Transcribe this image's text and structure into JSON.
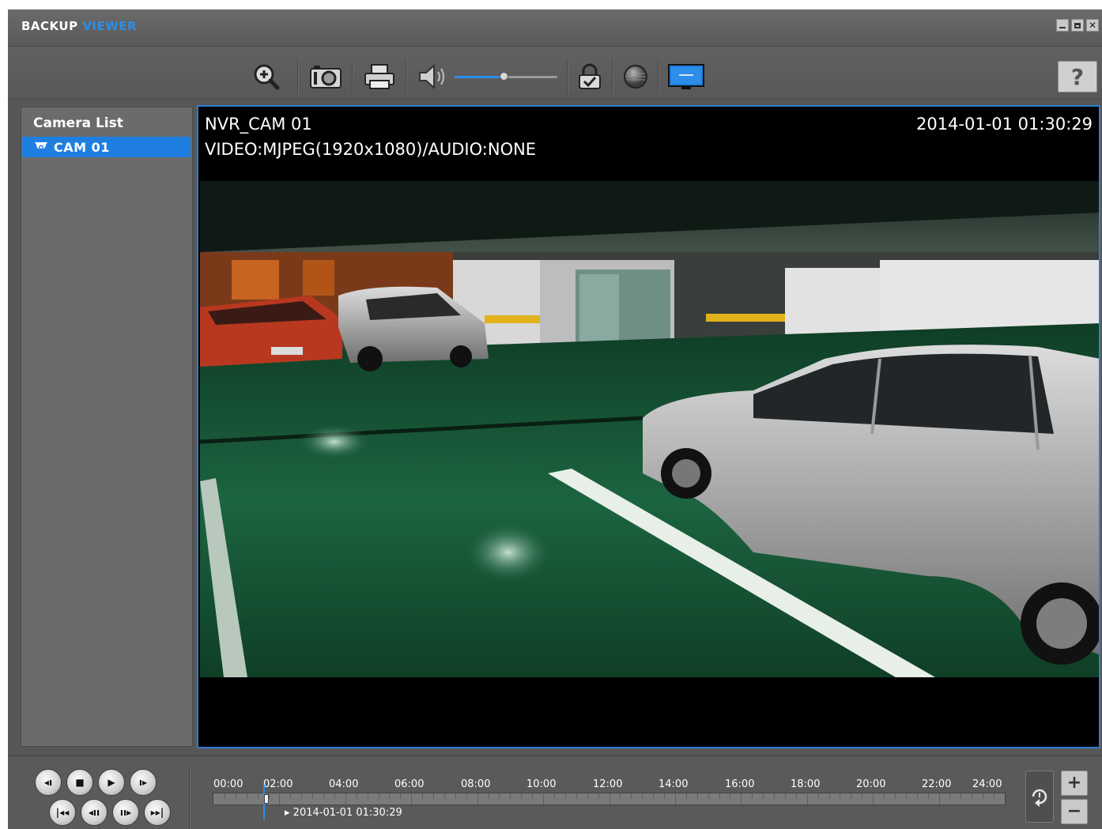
{
  "window": {
    "title_part1": "BACKUP",
    "title_part2": "VIEWER"
  },
  "toolbar": {
    "icons": [
      "zoom-in-icon",
      "snapshot-icon",
      "print-icon",
      "volume-icon",
      "lock-check-icon",
      "record-icon",
      "display-icon"
    ],
    "volume_level": 0.48,
    "help_label": "?"
  },
  "sidebar": {
    "title": "Camera List",
    "cameras": [
      {
        "label": "CAM 01",
        "selected": true
      }
    ]
  },
  "video": {
    "camera_name": "NVR_CAM 01",
    "datetime": "2014-01-01 01:30:29",
    "stream_info": "VIDEO:MJPEG(1920x1080)/AUDIO:NONE"
  },
  "timeline": {
    "hours": [
      "00:00",
      "02:00",
      "04:00",
      "06:00",
      "08:00",
      "10:00",
      "12:00",
      "14:00",
      "16:00",
      "18:00",
      "20:00",
      "22:00",
      "24:00"
    ],
    "current_time": "2014-01-01 01:30:29",
    "zoom_in_label": "+",
    "zoom_out_label": "−"
  },
  "colors": {
    "accent": "#2c8ee8",
    "selection": "#1f7fe0",
    "background": "#575757"
  }
}
